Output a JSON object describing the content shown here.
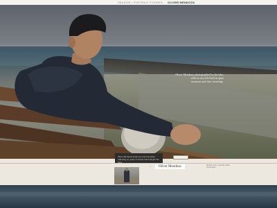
{
  "topbar": {
    "left_text": "SEASIDE • PORTRAIT STORIES",
    "right_text": "OLIVER MENDOZA"
  },
  "hero": {
    "quote_line1": "Oliver Mendoza, photographed by the lake,",
    "quote_line2": "reflects on a life built in quiet",
    "quote_line3": "moments and slow mornings."
  },
  "caption": {
    "text": "Oliver Mendoza looks out over the water, reflecting on years of stories that brought him here."
  },
  "profile": {
    "name": "Oliver Mendoza",
    "left_mark": "—",
    "side_text": "Portrait series, lakeside edition, final chapter"
  },
  "colors": {
    "band": "#ece8df",
    "dark": "#2e2c2a"
  }
}
